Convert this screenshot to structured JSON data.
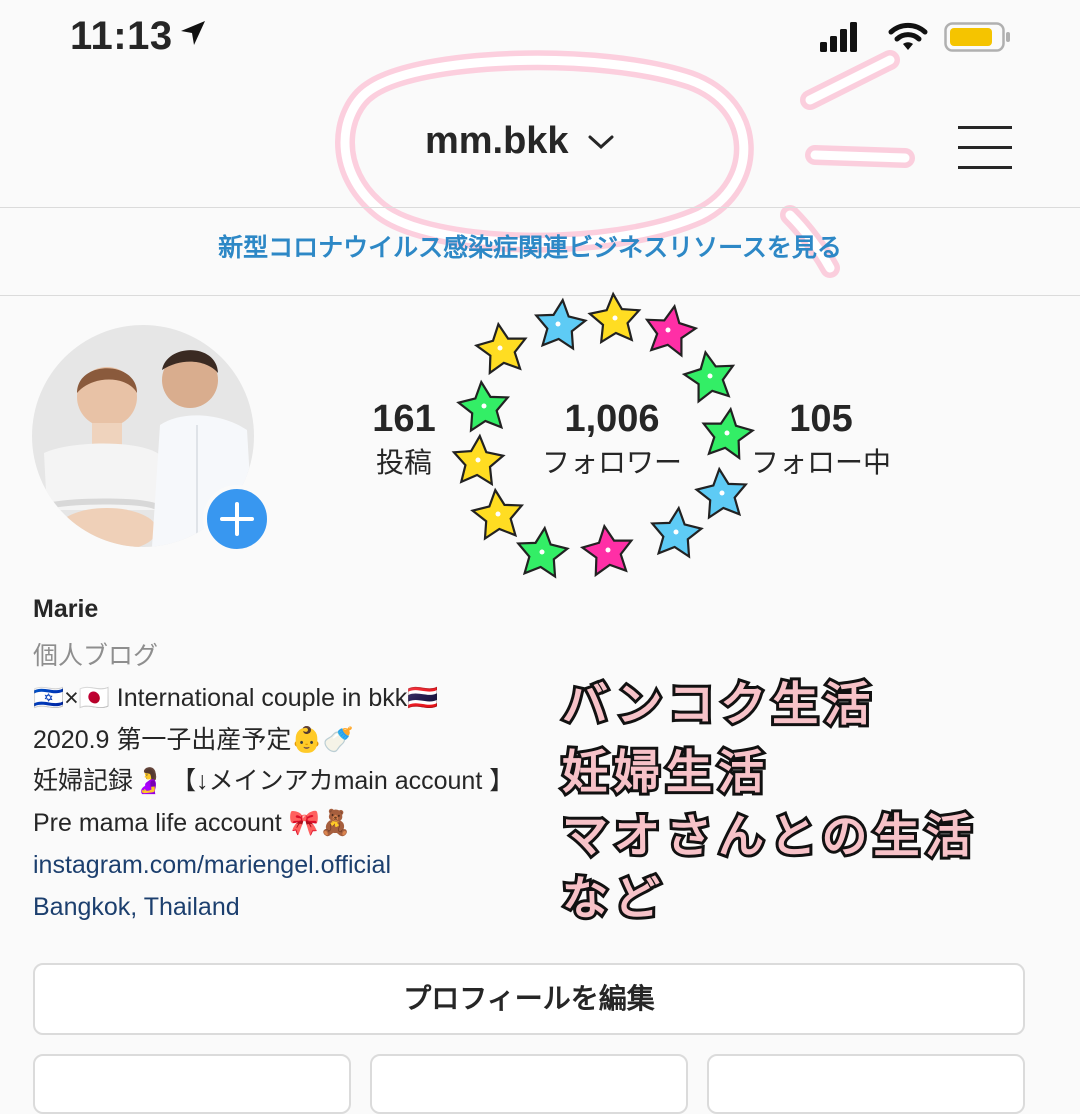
{
  "status_bar": {
    "time": "11:13"
  },
  "header": {
    "username": "mm.bkk"
  },
  "banner": {
    "text": "新型コロナウイルス感染症関連ビジネスリソースを見る"
  },
  "stats": [
    {
      "count": "161",
      "label": "投稿"
    },
    {
      "count": "1,006",
      "label": "フォロワー"
    },
    {
      "count": "105",
      "label": "フォロー中"
    }
  ],
  "bio": {
    "name": "Marie",
    "category": "個人ブログ",
    "line1": "🇮🇱×🇯🇵 International couple in bkk🇹🇭",
    "line2": "2020.9 第一子出産予定👶🍼",
    "line3": "妊婦記録🤰 【↓メインアカmain account 】",
    "line4": "Pre mama life account 🎀🧸",
    "link": "instagram.com/mariengel.official",
    "location": "Bangkok, Thailand"
  },
  "annotation": {
    "line1": "バンコク生活",
    "line2": "妊婦生活",
    "line3": "マオさんとの生活",
    "line4": "など"
  },
  "buttons": {
    "edit_profile": "プロフィールを編集"
  },
  "colors": {
    "accent": "#3897f0",
    "link": "#1c3f6e",
    "banner": "#2d88c6",
    "highlight": "#ff6fa0"
  },
  "icons": [
    "location-arrow-icon",
    "signal-icon",
    "wifi-icon",
    "battery-icon",
    "chevron-down-icon",
    "menu-icon",
    "plus-icon"
  ]
}
